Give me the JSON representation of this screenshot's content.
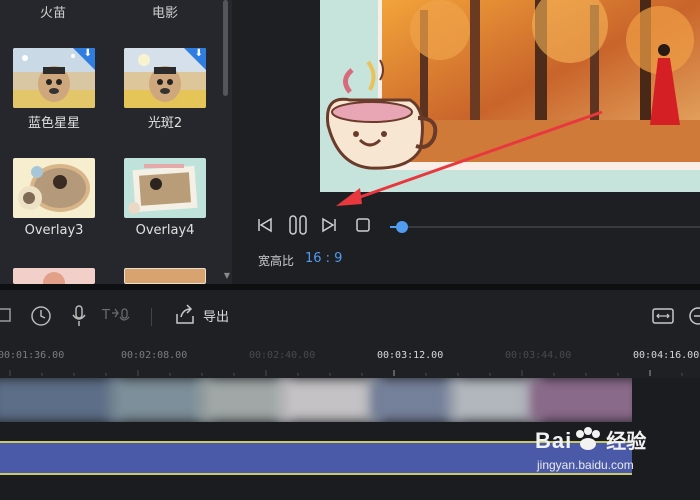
{
  "library": {
    "tabs": [
      "火苗",
      "电影"
    ],
    "items": [
      {
        "label": "蓝色星星",
        "downloadable": true
      },
      {
        "label": "光斑2",
        "downloadable": true
      },
      {
        "label": "Overlay3",
        "downloadable": false
      },
      {
        "label": "Overlay4",
        "downloadable": false
      }
    ],
    "download_icon": "download-arrow-icon"
  },
  "preview": {
    "aspect_label": "宽高比",
    "aspect_value": "16 : 9",
    "progress_fraction": 0.04,
    "accent_color": "#4f9cf0"
  },
  "toolbar": {
    "export_label": "导出",
    "icons": [
      "crop-icon",
      "clock-icon",
      "microphone-icon",
      "text-to-speech-icon",
      "export-icon",
      "fit-width-icon",
      "zoom-out-icon"
    ]
  },
  "timeline": {
    "ticks": [
      {
        "label": "00:01:36.00",
        "bright": false
      },
      {
        "label": "00:02:08.00",
        "bright": false
      },
      {
        "label": "00:02:40.00",
        "bright": false
      },
      {
        "label": "00:03:12.00",
        "bright": true
      },
      {
        "label": "00:03:44.00",
        "bright": false
      },
      {
        "label": "00:04:16.00",
        "bright": true
      }
    ]
  },
  "watermark": {
    "brand": "Bai",
    "brand_tail": "经验",
    "url": "jingyan.baidu.com"
  }
}
